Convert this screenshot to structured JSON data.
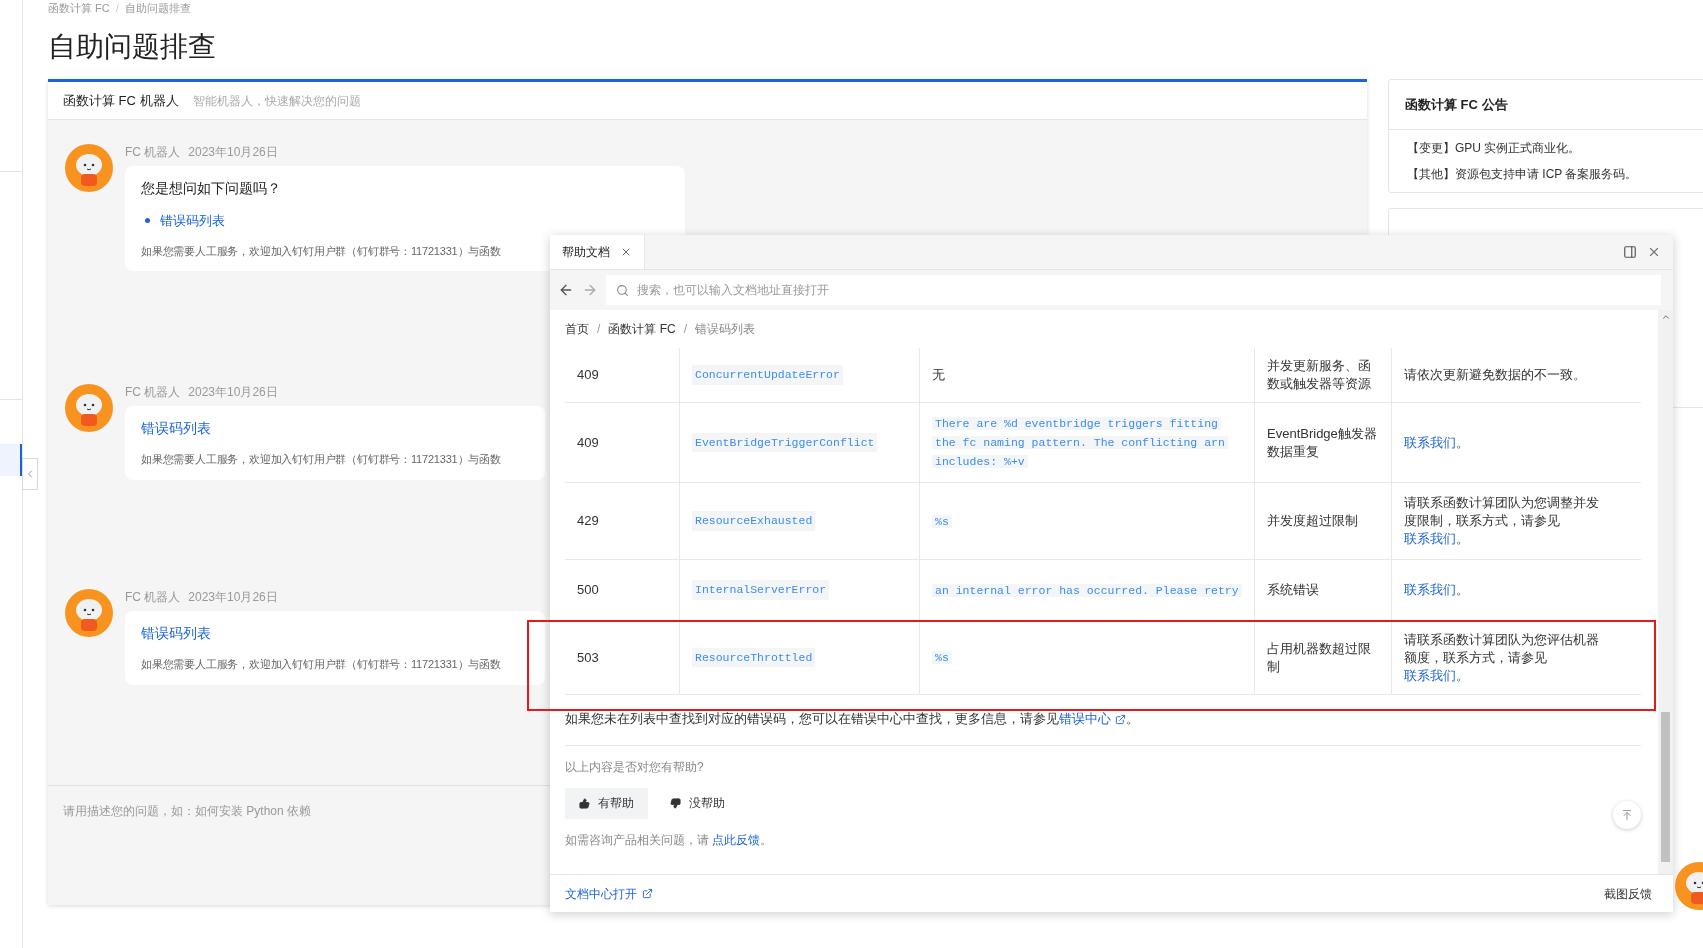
{
  "breadcrumb": [
    "函数计算 FC",
    "自助问题排查"
  ],
  "breadcrumb_separator": "/",
  "page_title": "自助问题排查",
  "chat": {
    "header": {
      "title": "函数计算 FC 机器人",
      "subtitle": "智能机器人，快速解决您的问题"
    },
    "messages": [
      {
        "kind": "suggestions",
        "sender": "FC 机器人",
        "date": "2023年10月26日",
        "question": "您是想问如下问题吗？",
        "links": [
          "错误码列表"
        ],
        "note": "如果您需要人工服务，欢迎加入钉钉用户群（钉钉群号：11721331）与函数"
      },
      {
        "kind": "link",
        "sender": "FC 机器人",
        "date": "2023年10月26日",
        "links": [
          "错误码列表"
        ],
        "note": "如果您需要人工服务，欢迎加入钉钉用户群（钉钉群号：11721331）与函数"
      },
      {
        "kind": "link",
        "sender": "FC 机器人",
        "date": "2023年10月26日",
        "links": [
          "错误码列表"
        ],
        "note": "如果您需要人工服务，欢迎加入钉钉用户群（钉钉群号：11721331）与函数"
      }
    ],
    "input": {
      "placeholder": "请用描述您的问题，如：如何安装 Python 依赖"
    }
  },
  "announcements": {
    "title": "函数计算 FC 公告",
    "items": [
      "【变更】GPU 实例正式商业化。",
      "【其他】资源包支持申请 ICP 备案服务码。"
    ]
  },
  "help": {
    "tab": {
      "label": "帮助文档",
      "selected": true
    },
    "search": {
      "placeholder": "搜索，也可以输入文档地址直接打开"
    },
    "breadcrumb": [
      "首页",
      "函数计算 FC",
      "错误码列表"
    ],
    "breadcrumb_separator": "/",
    "table": {
      "rows": [
        {
          "code": "409",
          "name": "ConcurrentUpdateError",
          "message": {
            "kind": "text",
            "text": "无"
          },
          "description": "并发更新服务、函数或触发器等资源",
          "solution": [
            {
              "text": "请依次更新避免数据的不一致。",
              "kind": "text"
            }
          ],
          "highlighted": false
        },
        {
          "code": "409",
          "name": "EventBridgeTriggerConflict",
          "message": {
            "kind": "code",
            "text": "There are %d eventbridge triggers fitting the fc naming pattern. The conflicting arn includes: %+v"
          },
          "description": "EventBridge触发器数据重复",
          "solution": [
            {
              "text": "联系我们",
              "kind": "link"
            },
            {
              "text": "。",
              "kind": "text"
            }
          ],
          "highlighted": false
        },
        {
          "code": "429",
          "name": "ResourceExhausted",
          "message": {
            "kind": "code",
            "text": "%s"
          },
          "description": "并发度超过限制",
          "solution": [
            {
              "text": "请联系函数计算团队为您调整并发度限制，联系方式，请参见",
              "kind": "text"
            },
            {
              "text": "联系我们",
              "kind": "link"
            },
            {
              "text": "。",
              "kind": "text"
            }
          ],
          "highlighted": false
        },
        {
          "code": "500",
          "name": "InternalServerError",
          "message": {
            "kind": "code",
            "text": "an internal error has occurred. Please retry"
          },
          "description": "系统错误",
          "solution": [
            {
              "text": "联系我们",
              "kind": "link"
            },
            {
              "text": "。",
              "kind": "text"
            }
          ],
          "highlighted": false
        },
        {
          "code": "503",
          "name": "ResourceThrottled",
          "message": {
            "kind": "code",
            "text": "%s"
          },
          "description": "占用机器数超过限制",
          "solution": [
            {
              "text": "请联系函数计算团队为您评估机器额度，联系方式，请参见",
              "kind": "text"
            },
            {
              "text": "联系我们",
              "kind": "link"
            },
            {
              "text": "。",
              "kind": "text"
            }
          ],
          "highlighted": true
        }
      ]
    },
    "footnote": {
      "before": "如果您未在列表中查找到对应的错误码，您可以在错误中心中查找，更多信息，请参见",
      "link": "错误中心",
      "after": "。"
    },
    "feedback": {
      "question": "以上内容是否对您有帮助?",
      "buttons": [
        {
          "kind": "up",
          "label": "有帮助",
          "selected": true
        },
        {
          "kind": "down",
          "label": "没帮助",
          "selected": false
        }
      ],
      "contact_before": "如需咨询产品相关问题，请 ",
      "contact_link": "点此反馈",
      "contact_after": "。"
    },
    "footer": {
      "open_link": "文档中心打开",
      "screenshot_feedback": "截图反馈"
    }
  }
}
